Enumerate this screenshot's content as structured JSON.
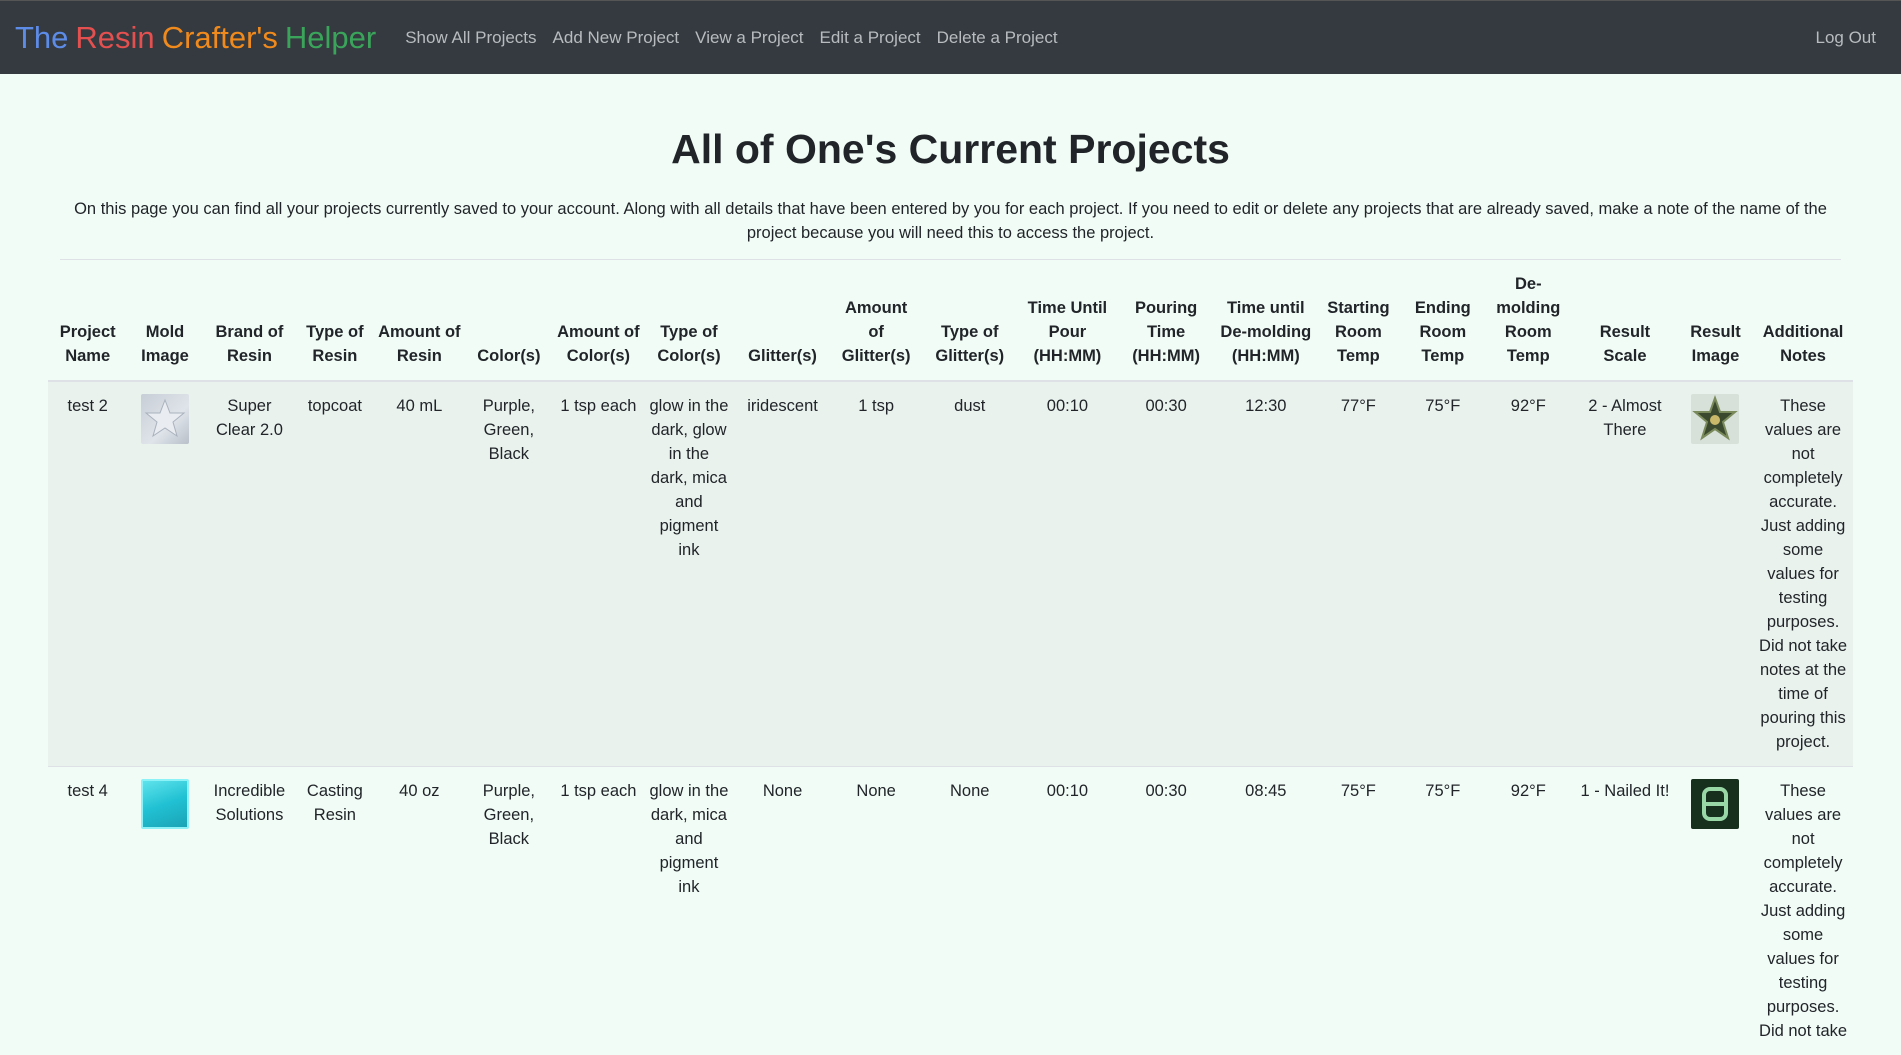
{
  "nav": {
    "brand": [
      {
        "text": "The",
        "color": "#5d8ce8"
      },
      {
        "text": "Resin",
        "color": "#e3504f"
      },
      {
        "text": "Crafter's",
        "color": "#f08a1c"
      },
      {
        "text": "Helper",
        "color": "#3aa55a"
      }
    ],
    "links": [
      "Show All Projects",
      "Add New Project",
      "View a Project",
      "Edit a Project",
      "Delete a Project"
    ],
    "logout": "Log Out"
  },
  "page": {
    "title": "All of One's Current Projects",
    "intro": "On this page you can find all your projects currently saved to your account. Along with all details that have been entered by you for each project. If you need to edit or delete any projects that are already saved, make a note of the name of the project because you will need this to access the project."
  },
  "table": {
    "headers": [
      "Project Name",
      "Mold Image",
      "Brand of Resin",
      "Type of Resin",
      "Amount of Resin",
      "Color(s)",
      "Amount of Color(s)",
      "Type of Color(s)",
      "Glitter(s)",
      "Amount of Glitter(s)",
      "Type of Glitter(s)",
      "Time Until Pour (HH:MM)",
      "Pouring Time (HH:MM)",
      "Time until De-molding (HH:MM)",
      "Starting Room Temp",
      "Ending Room Temp",
      "De-molding Room Temp",
      "Result Scale",
      "Result Image",
      "Additional Notes"
    ],
    "rows": [
      {
        "name": "test 2",
        "mold_image": "star-mold-icon",
        "brand": "Super Clear 2.0",
        "resin_type": "topcoat",
        "resin_amount": "40 mL",
        "colors": "Purple, Green, Black",
        "color_amount": "1 tsp each",
        "color_type": "glow in the dark, glow in the dark, mica and pigment ink",
        "glitter": "iridescent",
        "glitter_amount": "1 tsp",
        "glitter_type": "dust",
        "time_until_pour": "00:10",
        "pouring_time": "00:30",
        "time_until_demold": "12:30",
        "start_temp": "77°F",
        "end_temp": "75°F",
        "demold_temp": "92°F",
        "result_scale": "2 - Almost There",
        "result_image": "star-result-icon",
        "notes": "These values are not completely accurate. Just adding some values for testing purposes. Did not take notes at the time of pouring this project."
      },
      {
        "name": "test 4",
        "mold_image": "square-mold-icon",
        "brand": "Incredible Solutions",
        "resin_type": "Casting Resin",
        "resin_amount": "40 oz",
        "colors": "Purple, Green, Black",
        "color_amount": "1 tsp each",
        "color_type": "glow in the dark, mica and pigment ink",
        "glitter": "None",
        "glitter_amount": "None",
        "glitter_type": "None",
        "time_until_pour": "00:10",
        "pouring_time": "00:30",
        "time_until_demold": "08:45",
        "start_temp": "75°F",
        "end_temp": "75°F",
        "demold_temp": "92°F",
        "result_scale": "1 - Nailed It!",
        "result_image": "square-result-icon",
        "notes": "These values are not completely accurate. Just adding some values for testing purposes. Did not take"
      }
    ]
  }
}
